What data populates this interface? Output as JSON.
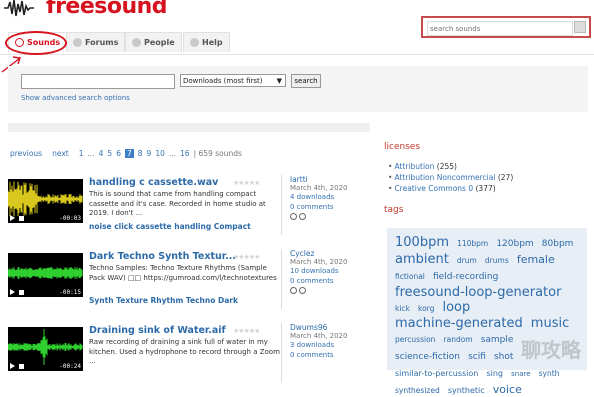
{
  "header": {
    "logo_text": "freesound",
    "search_placeholder": "search sounds"
  },
  "nav": {
    "tabs": [
      {
        "label": "Sounds",
        "icon": "headphones-icon",
        "active": true
      },
      {
        "label": "Forums",
        "icon": "chat-bubble-icon",
        "active": false
      },
      {
        "label": "People",
        "icon": "people-icon",
        "active": false
      },
      {
        "label": "Help",
        "icon": "help-icon",
        "active": false
      }
    ]
  },
  "search": {
    "query_value": "",
    "sort_value": "Downloads (most first)",
    "button_label": "search",
    "advanced_link": "Show advanced search options"
  },
  "pagination": {
    "previous": "previous",
    "next": "next",
    "pages": [
      "1",
      "...",
      "4",
      "5",
      "6",
      "7",
      "8",
      "9",
      "10",
      "...",
      "16"
    ],
    "current": "7",
    "count_text": "| 659 sounds"
  },
  "results": [
    {
      "title": "handling c cassette.wav",
      "description": "This is sound that came from handling compact cassette and it's case. Recorded in home studio at 2019. I don't ...",
      "tags": "noise click cassette handling Compact",
      "user": "lartti",
      "date": "March 4th, 2020",
      "downloads": "4 downloads",
      "comments": "0 comments",
      "time": "-00:03",
      "wave_color": "#d8c81e"
    },
    {
      "title": "Dark Techno Synth Textur...",
      "description": "Techno Samples: Techno Texture Rhythms (Sample Pack WAV) □□ https://gumroad.com/l/technotextures",
      "tags": "Synth Texture Rhythm Techno Dark",
      "user": "Cyclez",
      "date": "March 4th, 2020",
      "downloads": "10 downloads",
      "comments": "0 comments",
      "time": "-00:15",
      "wave_color": "#2fcf2f"
    },
    {
      "title": "Draining sink of Water.aif",
      "description": "Raw recording of draining a sink full of water in my kitchen. Used a hydrophone to record through a Zoom ...",
      "tags": "",
      "user": "Dwums96",
      "date": "March 4th, 2020",
      "downloads": "3 downloads",
      "comments": "0 comments",
      "time": "-00:24",
      "wave_color": "#2fcf2f"
    }
  ],
  "sidebar": {
    "licenses_heading": "licenses",
    "licenses": [
      {
        "name": "Attribution",
        "count": "(255)"
      },
      {
        "name": "Attribution Noncommercial",
        "count": "(27)"
      },
      {
        "name": "Creative Commons 0",
        "count": "(377)"
      }
    ],
    "tags_heading": "tags",
    "tags": [
      {
        "text": "100bpm",
        "size": 13
      },
      {
        "text": "110bpm",
        "size": 7.5
      },
      {
        "text": "120bpm",
        "size": 9
      },
      {
        "text": "80bpm",
        "size": 9
      },
      {
        "text": "ambient",
        "size": 13
      },
      {
        "text": "drum",
        "size": 7.5
      },
      {
        "text": "drums",
        "size": 7.5
      },
      {
        "text": "female",
        "size": 11
      },
      {
        "text": "fictional",
        "size": 7.5
      },
      {
        "text": "field-recording",
        "size": 9
      },
      {
        "text": "freesound-loop-generator",
        "size": 13
      },
      {
        "text": "kick",
        "size": 7.5
      },
      {
        "text": "korg",
        "size": 7.5
      },
      {
        "text": "loop",
        "size": 13
      },
      {
        "text": "machine-generated",
        "size": 13
      },
      {
        "text": "music",
        "size": 13
      },
      {
        "text": "percussion",
        "size": 7.5
      },
      {
        "text": "random",
        "size": 7.5
      },
      {
        "text": "sample",
        "size": 9
      },
      {
        "text": "science-fiction",
        "size": 9
      },
      {
        "text": "scifi",
        "size": 9
      },
      {
        "text": "shot",
        "size": 9
      },
      {
        "text": "similar-to-percussion",
        "size": 8
      },
      {
        "text": "sing",
        "size": 8
      },
      {
        "text": "snare",
        "size": 7
      },
      {
        "text": "synth",
        "size": 7.5
      },
      {
        "text": "synthesized",
        "size": 7.5
      },
      {
        "text": "synthetic",
        "size": 8
      },
      {
        "text": "voice",
        "size": 11
      }
    ]
  },
  "watermark": "聊攻略"
}
